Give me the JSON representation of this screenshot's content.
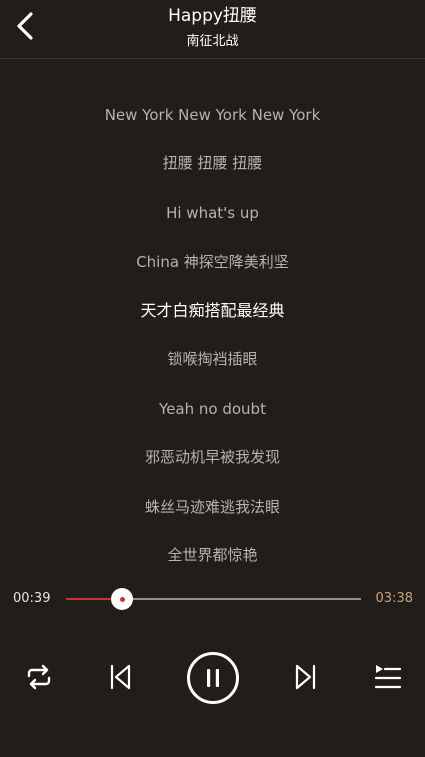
{
  "header": {
    "title": "Happy扭腰",
    "artist": "南征北战"
  },
  "lyrics": {
    "lines": [
      "New York New York New York",
      "扭腰 扭腰 扭腰",
      "Hi what's up",
      "China 神探空降美利坚",
      "天才白痴搭配最经典",
      "锁喉掏裆插眼",
      "Yeah no doubt",
      "邪恶动机早被我发现",
      "蛛丝马迹难逃我法眼",
      "全世界都惊艳"
    ],
    "active_index": 4
  },
  "player": {
    "current_time": "00:39",
    "total_time": "03:38",
    "progress_fraction": 0.19
  },
  "controls": {
    "loop": "loop-icon",
    "previous": "previous-icon",
    "play_pause": "pause-icon",
    "next": "next-icon",
    "playlist": "playlist-icon"
  },
  "colors": {
    "background": "#211d1b",
    "accent": "#c4342e",
    "total_time": "#c9a27a"
  }
}
